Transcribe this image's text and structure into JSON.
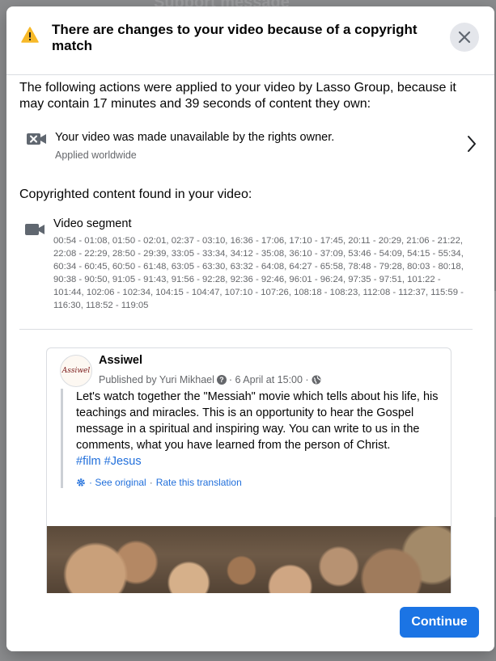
{
  "background": {
    "title": "Support message"
  },
  "dialog": {
    "title": "There are changes to your video because of a copyright match",
    "intro": "The following actions were applied to your video by Lasso Group, because it may contain 17 minutes and 39 seconds of content they own:",
    "action": {
      "title": "Your video was made unavailable by the rights owner.",
      "subtitle": "Applied worldwide"
    },
    "content_heading": "Copyrighted content found in your video:",
    "segment": {
      "title": "Video segment",
      "times": "00:54 - 01:08, 01:50 - 02:01, 02:37 - 03:10, 16:36 - 17:06, 17:10 - 17:45, 20:11 - 20:29, 21:06 - 21:22, 22:08 - 22:29, 28:50 - 29:39, 33:05 - 33:34, 34:12 - 35:08, 36:10 - 37:09, 53:46 - 54:09, 54:15 - 55:34, 60:34 - 60:45, 60:50 - 61:48, 63:05 - 63:30, 63:32 - 64:08, 64:27 - 65:58, 78:48 - 79:28, 80:03 - 80:18, 90:38 - 90:50, 91:05 - 91:43, 91:56 - 92:28, 92:36 - 92:46, 96:01 - 96:24, 97:35 - 97:51, 101:22 - 101:44, 102:06 - 102:34, 104:15 - 104:47, 107:10 - 107:26, 108:18 - 108:23, 112:08 - 112:37, 115:59 - 116:30, 118:52 - 119:05"
    },
    "post": {
      "avatar_text": "Assiwel",
      "author": "Assiwel",
      "published_by": "Published by Yuri Mikhael",
      "date": "· 6 April at 15:00 ·",
      "text": "Let's watch together the \"Messiah\" movie which tells about his life, his teachings and miracles. This is an opportunity to hear the Gospel message in a spiritual and inspiring way. You can write to us in the comments, what you have learned from the person of Christ.",
      "hashtags": [
        "#film",
        "#Jesus"
      ],
      "see_original": "· See original",
      "separator": "·",
      "rate_translation": "Rate this translation"
    },
    "continue_label": "Continue"
  },
  "colors": {
    "accent": "#1b74e4",
    "link": "#216fdb",
    "warning": "#f7b928"
  },
  "icons": [
    "warning-icon",
    "close-icon",
    "video-off-icon",
    "chevron-right-icon",
    "video-camera-icon",
    "help-icon",
    "globe-icon",
    "gear-icon"
  ]
}
